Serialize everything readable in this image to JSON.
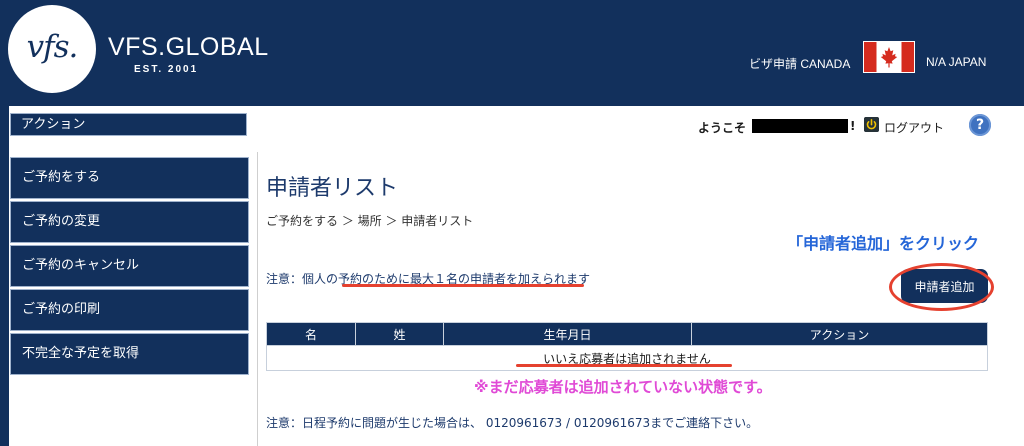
{
  "header": {
    "logo_text": "vfs.",
    "brand_name": "VFS.GLOBAL",
    "brand_est": "EST. 2001",
    "visa_label": "ビザ申請 CANADA",
    "country_label": "N/A JAPAN",
    "colors": {
      "navy": "#12305c",
      "flag_red": "#d52b1e"
    }
  },
  "topbar": {
    "action_label": "アクション",
    "welcome": "ようこそ",
    "welcome_suffix": "!",
    "logout": "ログアウト",
    "help": "?"
  },
  "sidebar": {
    "items": [
      {
        "label": "ご予約をする"
      },
      {
        "label": "ご予約の変更"
      },
      {
        "label": "ご予約のキャンセル"
      },
      {
        "label": "ご予約の印刷"
      },
      {
        "label": "不完全な予定を取得"
      }
    ]
  },
  "main": {
    "title": "申請者リスト",
    "breadcrumb": "ご予約をする ＞ 場所 ＞ 申請者リスト",
    "notice1": "注意：個人の予約のために最大１名の申請者を加えられます",
    "add_button": "申請者追加",
    "table": {
      "headers": [
        "名",
        "姓",
        "生年月日",
        "アクション"
      ],
      "empty_message": "いいえ応募者は追加されません"
    },
    "notice2": "注意：日程予約に問題が生じた場合は、 0120961673 / 0120961673までご連絡下さい。"
  },
  "annotations": {
    "click_hint": "「申請者追加」をクリック",
    "none_hint": "※まだ応募者は追加されていない状態です。",
    "colors": {
      "red": "#e5412f",
      "blue": "#2566d8",
      "magenta": "#e04ad6"
    }
  }
}
